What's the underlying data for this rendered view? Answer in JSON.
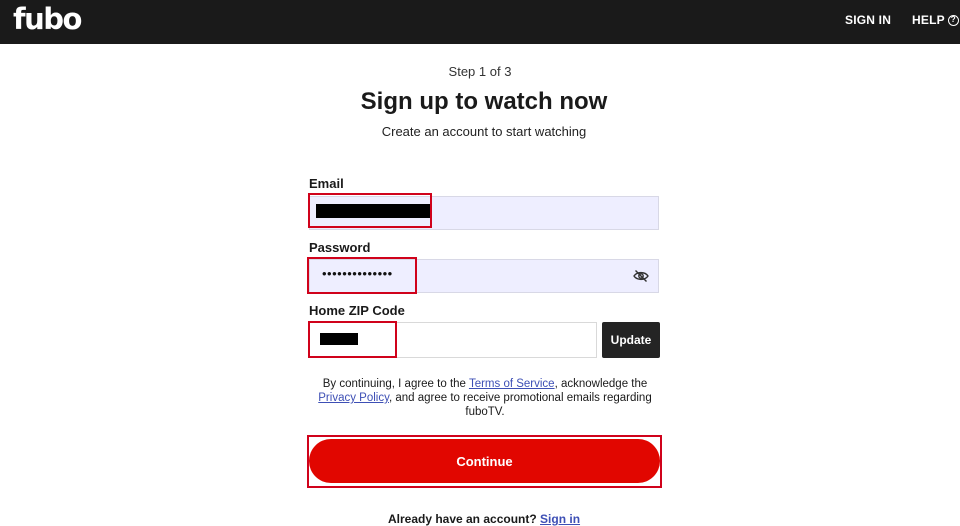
{
  "header": {
    "logo": "fubo",
    "sign_in": "SIGN IN",
    "help": "HELP",
    "help_icon": "question-circle-icon"
  },
  "form": {
    "step": "Step 1 of 3",
    "title": "Sign up to watch now",
    "subtitle": "Create an account to start watching",
    "email_label": "Email",
    "password_label": "Password",
    "password_value": "••••••••••••••",
    "password_toggle_icon": "eye-slash-icon",
    "zip_label": "Home ZIP Code",
    "update_label": "Update",
    "terms_prefix": "By continuing, I agree to the",
    "terms_link": "Terms of Service",
    "terms_middle": ", acknowledge the",
    "privacy_link": "Privacy Policy",
    "terms_suffix": ", and agree to receive promotional emails regarding fuboTV.",
    "continue_label": "Continue",
    "already_text": "Already have an account?",
    "sign_in_link": "Sign in"
  },
  "colors": {
    "header_bg": "#1a1a1a",
    "accent_red": "#e10600",
    "link": "#3d4fb5",
    "highlight_box": "#d0021b"
  }
}
